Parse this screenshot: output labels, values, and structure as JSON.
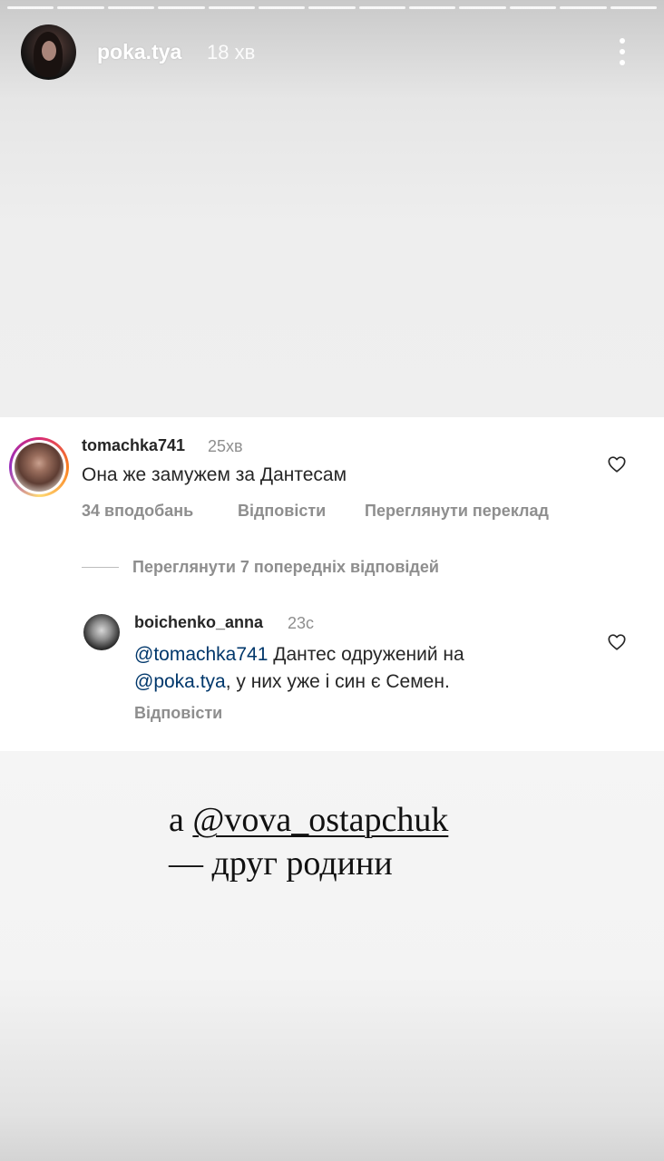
{
  "story": {
    "username": "poka.tya",
    "time": "18 хв",
    "progress_segments": 13,
    "active_segment": 13
  },
  "comment": {
    "username": "tomachka741",
    "time": "25хв",
    "text": "Она же замужем за Дантесам",
    "likes": "34 вподобань",
    "reply": "Відповісти",
    "translate": "Переглянути переклад"
  },
  "view_previous": "Переглянути 7 попередніх відповідей",
  "reply": {
    "username": "boichenko_anna",
    "time": "23с",
    "mention1": "@tomachka741",
    "text1": " Дантес одружений на",
    "mention2": "@poka.tya",
    "text2": ", у них уже і син є Семен.",
    "reply_label": "Відповісти"
  },
  "caption": {
    "prefix": "а ",
    "mention": "@vova_ostapchuk",
    "line2": "— друг родини"
  }
}
